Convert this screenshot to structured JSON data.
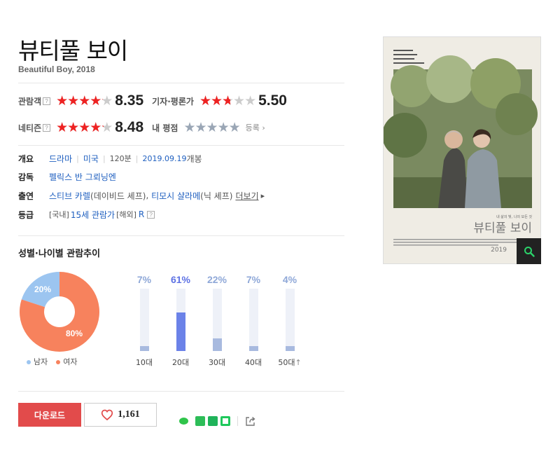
{
  "movie": {
    "title": "뷰티풀 보이",
    "subtitle": "Beautiful Boy, 2018"
  },
  "ratings": {
    "audience": {
      "label": "관람객",
      "help": "?",
      "score": "8.35",
      "fraction": 0.835
    },
    "critic": {
      "label": "기자·평론가",
      "score": "5.50",
      "fraction": 0.55
    },
    "netizen": {
      "label": "네티즌",
      "help": "?",
      "score": "8.48",
      "fraction": 0.848
    },
    "mine": {
      "label": "내 평점",
      "register": "등록",
      "fraction": 0
    }
  },
  "stars_glyph": "★★★★★",
  "info": {
    "overview_label": "개요",
    "genre": "드라마",
    "country": "미국",
    "runtime": "120분",
    "release_date": "2019.09.19",
    "release_suffix": "개봉",
    "director_label": "감독",
    "director": "펠릭스 반 그뢰닝엔",
    "cast_label": "출연",
    "cast1": "스티브 카렐",
    "cast1_role": "(데이비드 셰프)",
    "cast_sep": ", ",
    "cast2": "티모시 샬라메",
    "cast2_role": "(닉 셰프)",
    "more": "더보기",
    "grade_label": "등급",
    "grade_domestic_prefix": "[국내]",
    "grade_domestic": "15세 관람가",
    "grade_foreign_prefix": "[해외]",
    "grade_foreign": "R",
    "grade_help": "?"
  },
  "trend": {
    "title": "성별·나이별 관람추이",
    "gender": {
      "male_pct": 20,
      "female_pct": 80,
      "male_label": "20%",
      "female_label": "80%",
      "male_legend": "남자",
      "female_legend": "여자",
      "male_color": "#9cc5f0",
      "female_color": "#f7825d"
    },
    "ages": [
      {
        "label": "10대",
        "pct_label": "7%",
        "value": 7,
        "highlight": false
      },
      {
        "label": "20대",
        "pct_label": "61%",
        "value": 61,
        "highlight": true
      },
      {
        "label": "30대",
        "pct_label": "22%",
        "value": 22,
        "highlight": false
      },
      {
        "label": "40대",
        "pct_label": "7%",
        "value": 7,
        "highlight": false
      },
      {
        "label": "50대",
        "pct_label": "4%",
        "value": 4,
        "highlight": false
      }
    ],
    "ages_max": 61,
    "arrow_up": "↑"
  },
  "actions": {
    "download": "다운로드",
    "like_count": "1,161"
  },
  "poster": {
    "title": "뷰티풀 보이",
    "tagline": "내 삶의 빛, 나의 모든 것",
    "date": "2019"
  },
  "colors": {
    "accent_red": "#e24b4b",
    "star_red": "#e22222",
    "link_blue": "#2060c0"
  }
}
